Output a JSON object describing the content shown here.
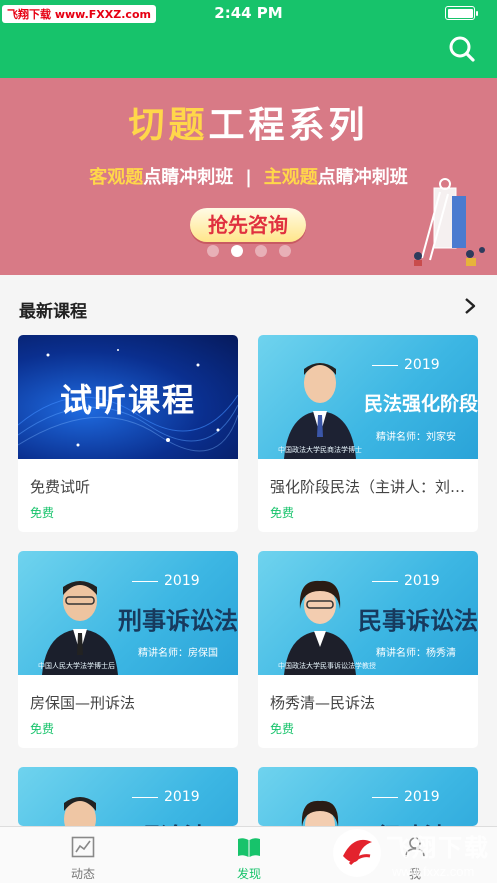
{
  "status": {
    "time": "2:44 PM",
    "watermark": "飞翔下载 www.FXXZ.com"
  },
  "header": {
    "search_icon": "search-icon"
  },
  "banner": {
    "title_part1": "切题",
    "title_part2": "工程系列",
    "sub_a_hl": "客观题",
    "sub_a": "点睛冲刺班",
    "separator": "|",
    "sub_b_hl": "主观题",
    "sub_b": "点睛冲刺班",
    "cta": "抢先咨询",
    "dots_total": 4,
    "dots_active": 2
  },
  "section": {
    "title": "最新课程",
    "more_icon": "chevron-right-icon"
  },
  "courses": [
    {
      "thumb_text": "试听课程",
      "title": "免费试听",
      "price": "免费"
    },
    {
      "year": "2019",
      "big": "民法强化阶段",
      "tag": "精讲名师：刘家安",
      "foot": "中国政法大学民商法学博士",
      "title": "强化阶段民法（主讲人：刘家安）",
      "price": "免费"
    },
    {
      "year": "2019",
      "big": "刑事诉讼法",
      "tag": "精讲名师：房保国",
      "foot": "中国人民大学法学博士后",
      "title": "房保国—刑诉法",
      "price": "免费"
    },
    {
      "year": "2019",
      "big": "民事诉讼法",
      "tag": "精讲名师：杨秀清",
      "foot": "中国政法大学民事诉讼法学教授",
      "title": "杨秀清—民诉法",
      "price": "免费"
    },
    {
      "year": "2019",
      "big": "理论法"
    },
    {
      "year": "2019",
      "big": "行政法"
    }
  ],
  "tabs": [
    {
      "label": "动态",
      "icon": "chart-icon"
    },
    {
      "label": "发现",
      "icon": "book-icon"
    },
    {
      "label": "我",
      "icon": "person-icon"
    }
  ],
  "overlay_watermark": {
    "brand": "飞翔下载",
    "url": "www.fxxz.com"
  },
  "colors": {
    "accent": "#17c36b",
    "banner_bg": "#d87a86",
    "highlight": "#ffd74a"
  }
}
